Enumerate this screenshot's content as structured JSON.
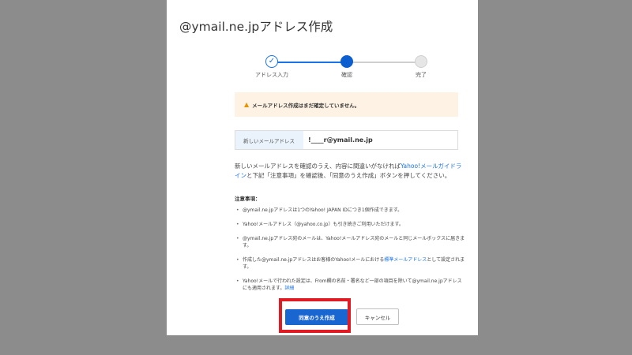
{
  "page": {
    "title": "@ymail.ne.jpアドレス作成"
  },
  "steps": [
    {
      "label": "アドレス入力",
      "state": "done"
    },
    {
      "label": "確認",
      "state": "active"
    },
    {
      "label": "完了",
      "state": "todo"
    }
  ],
  "alert": {
    "icon": "warning-icon",
    "text": "メールアドレス作成はまだ確定していません。"
  },
  "address": {
    "label": "新しいメールアドレス",
    "value": "!____r@ymail.ne.jp"
  },
  "description": {
    "before_link": "新しいメールアドレスを確認のうえ、内容に間違いがなければ",
    "link": "Yahoo!メールガイドライン",
    "after_link": "と下記「注意事項」を確認後、「同意のうえ作成」ボタンを押してください。"
  },
  "notes": {
    "title": "注意事項：",
    "items": [
      "@ymail.ne.jpアドレスは1つのYahoo! JAPAN IDにつき1個作成できます。",
      "Yahoo!メールアドレス（@yahoo.co.jp）も引き続きご利用いただけます。",
      "@ymail.ne.jpアドレス宛のメールは、Yahoo!メールアドレス宛のメールと同じメールボックスに届きます。"
    ],
    "item4_before": "作成した@ymail.ne.jpアドレスはお客様のYahoo!メールにおける",
    "item4_link": "標準メールアドレス",
    "item4_after": "として設定されます。",
    "item5_text": "Yahoo!メールで行われた設定は、From欄の名前・署名など一部の項目を除いて@ymail.ne.jpアドレスにも適用されます。",
    "item5_link": "詳細"
  },
  "buttons": {
    "agree": "同意のうえ作成",
    "cancel": "キャンセル"
  },
  "colors": {
    "accent": "#1a66d1",
    "highlight": "#e01b24",
    "alert_bg": "#fdf2e3"
  }
}
